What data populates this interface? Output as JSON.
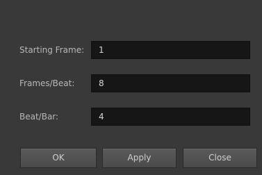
{
  "form": {
    "fields": [
      {
        "label": "Starting Frame:",
        "value": "1"
      },
      {
        "label": "Frames/Beat:",
        "value": "8"
      },
      {
        "label": "Beat/Bar:",
        "value": "4"
      }
    ]
  },
  "buttons": {
    "ok": "OK",
    "apply": "Apply",
    "close": "Close"
  }
}
